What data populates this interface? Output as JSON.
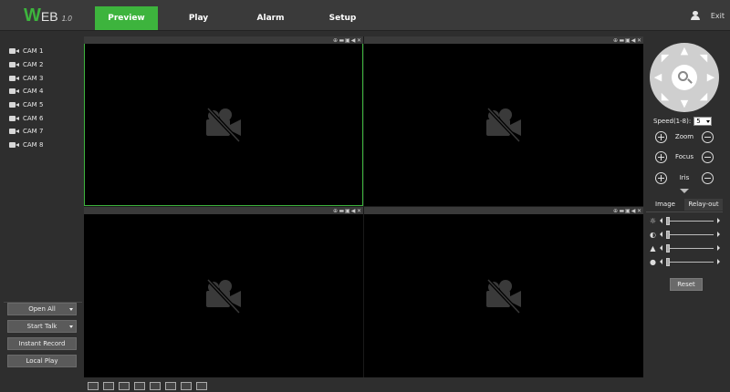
{
  "logo": {
    "w": "W",
    "eb": "EB",
    "version": "1.0"
  },
  "tabs": [
    {
      "label": "Preview",
      "active": true
    },
    {
      "label": "Play"
    },
    {
      "label": "Alarm"
    },
    {
      "label": "Setup"
    }
  ],
  "user": {
    "exit_label": "Exit"
  },
  "cameras": [
    "CAM 1",
    "CAM 2",
    "CAM 3",
    "CAM 4",
    "CAM 5",
    "CAM 6",
    "CAM 7",
    "CAM 8"
  ],
  "left_buttons": {
    "open_all": "Open All",
    "start_talk": "Start Talk",
    "instant_record": "Instant Record",
    "local_play": "Local Play"
  },
  "ptz": {
    "speed_label": "Speed(1-8):",
    "speed_value": "5",
    "zoom_label": "Zoom",
    "focus_label": "Focus",
    "iris_label": "Iris"
  },
  "image_tabs": {
    "image": "Image",
    "relay_out": "Relay-out"
  },
  "image_controls": {
    "reset_label": "Reset"
  },
  "colors": {
    "accent": "#3db43d",
    "background": "#2e2e2e",
    "video_bg": "#000000"
  }
}
